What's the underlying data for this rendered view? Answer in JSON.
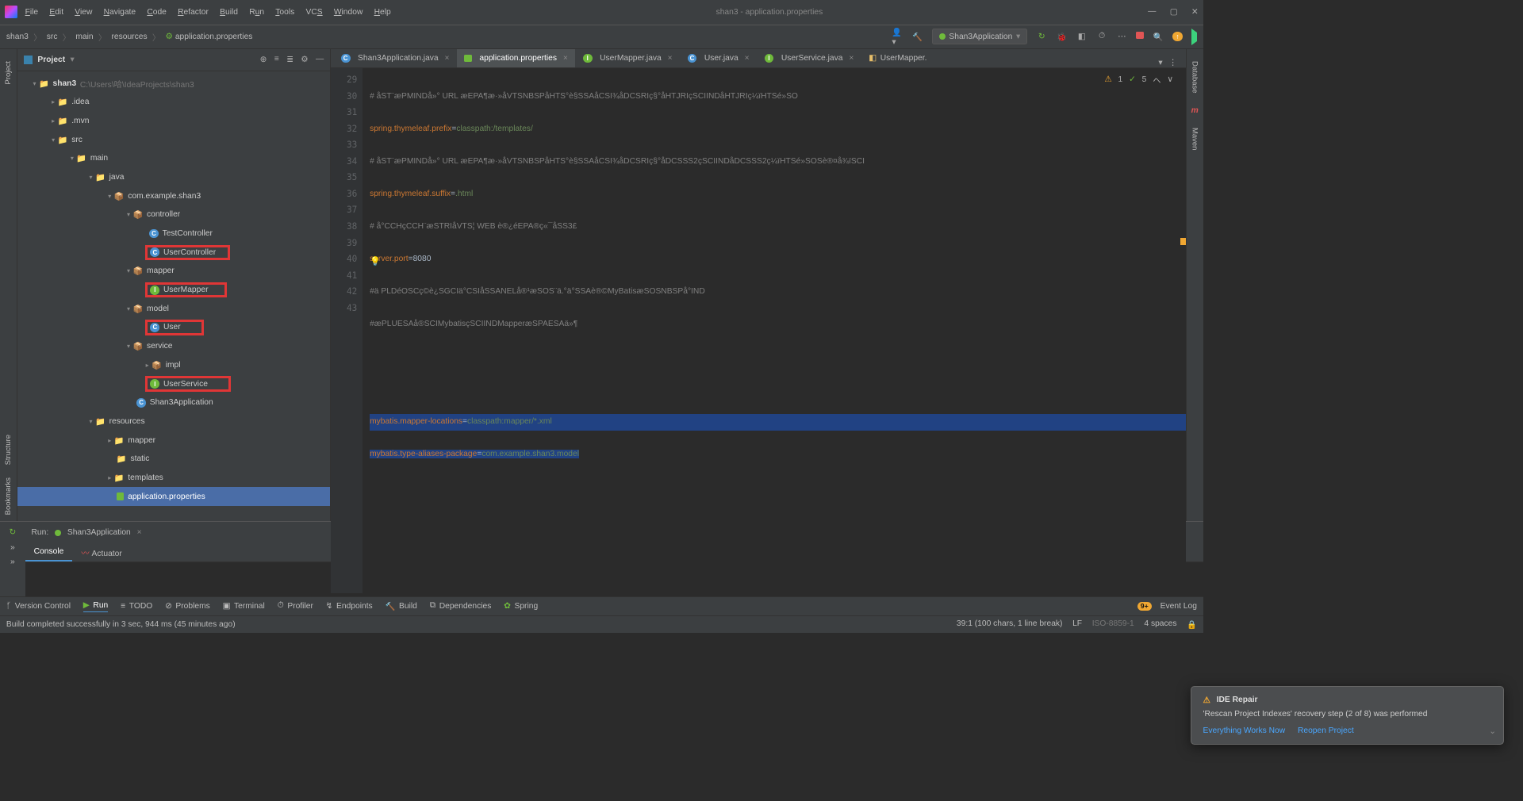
{
  "window_title": "shan3 - application.properties",
  "menu": [
    "File",
    "Edit",
    "View",
    "Navigate",
    "Code",
    "Refactor",
    "Build",
    "Run",
    "Tools",
    "VCS",
    "Window",
    "Help"
  ],
  "breadcrumb": [
    "shan3",
    "src",
    "main",
    "resources",
    "application.properties"
  ],
  "run_config_label": "Shan3Application",
  "project_panel_title": "Project",
  "project_root": "shan3",
  "project_root_path": "C:\\Users\\哈\\IdeaProjects\\shan3",
  "tree": {
    "idea": ".idea",
    "mvn": ".mvn",
    "src": "src",
    "main": "main",
    "java": "java",
    "pkg": "com.example.shan3",
    "controller": "controller",
    "TestController": "TestController",
    "UserController": "UserController",
    "mapper": "mapper",
    "UserMapper": "UserMapper",
    "model": "model",
    "User": "User",
    "service": "service",
    "impl": "impl",
    "UserService": "UserService",
    "Shan3Application": "Shan3Application",
    "resources": "resources",
    "res_mapper": "mapper",
    "static": "static",
    "templates": "templates",
    "app_props": "application.properties"
  },
  "tabs": [
    {
      "label": "Shan3Application.java",
      "type": "class",
      "active": false
    },
    {
      "label": "application.properties",
      "type": "prop",
      "active": true
    },
    {
      "label": "UserMapper.java",
      "type": "iface",
      "active": false
    },
    {
      "label": "User.java",
      "type": "class",
      "active": false
    },
    {
      "label": "UserService.java",
      "type": "iface",
      "active": false
    },
    {
      "label": "UserMapper.",
      "type": "xml",
      "active": false
    }
  ],
  "editor": {
    "lines_start": 29,
    "lines_end": 43,
    "l29": "# åST¨æPMINDå»° URL æEPA¶æ·»åVTSNBSPåHTS°è§SSAåCSI¾åDCSRIç§°åHTJRIçSCIINDåHTJRIç¼ïHTSé»SO",
    "l30_key": "spring.thymeleaf.prefix",
    "l30_val": "classpath:/templates/",
    "l31": "# åST¨æPMINDå»° URL æEPA¶æ·»åVTSNBSPåHTS°è§SSAåCSI¾åDCSRIç§°åDCSSS2çSCIINDåDCSSS2ç¼ïHTSé»SOSè®¤å¾ïSCI",
    "l32_key": "spring.thymeleaf.suffix",
    "l32_val": ".html",
    "l33": "# å°CCHçCCH¨æSTRIåVTS¦ WEB è®¿éEPA®ç«¯åSS3£",
    "l34_key": "server.port",
    "l34_val": "8080",
    "l35": "#ä PLDéOSCç©è¿SGCIä°CSIåSSANELå®¹æSOS¨ä.°ä°SSAè®©MyBatisæSOSNBSPå°IND",
    "l36": "#æPLUESAå®SCIMybatisçSCIINDMapperæSPAESAä»¶",
    "l39_key": "mybatis.mapper-locations",
    "l39_val": "classpath:mapper/*.xml",
    "l40_key": "mybatis.type-aliases-package",
    "l40_val": "com.example.shan3.model",
    "warn_count": "1",
    "check_count": "5"
  },
  "run": {
    "label": "Run:",
    "config": "Shan3Application",
    "tabs": [
      "Console",
      "Actuator"
    ]
  },
  "bottom_tools": [
    "Version Control",
    "Run",
    "TODO",
    "Problems",
    "Terminal",
    "Profiler",
    "Endpoints",
    "Build",
    "Dependencies",
    "Spring"
  ],
  "event_log": "Event Log",
  "status_msg": "Build completed successfully in 3 sec, 944 ms (45 minutes ago)",
  "status_right": {
    "pos": "39:1 (100 chars, 1 line break)",
    "sep": "LF",
    "enc": "ISO-8859-1",
    "indent": "4 spaces"
  },
  "notif": {
    "title": "IDE Repair",
    "body": "'Rescan Project Indexes' recovery step (2 of 8) was performed",
    "link1": "Everything Works Now",
    "link2": "Reopen Project"
  },
  "left_gutter": [
    "Project",
    "Bookmarks",
    "Structure"
  ],
  "right_gutter": [
    "Database",
    "Maven"
  ]
}
